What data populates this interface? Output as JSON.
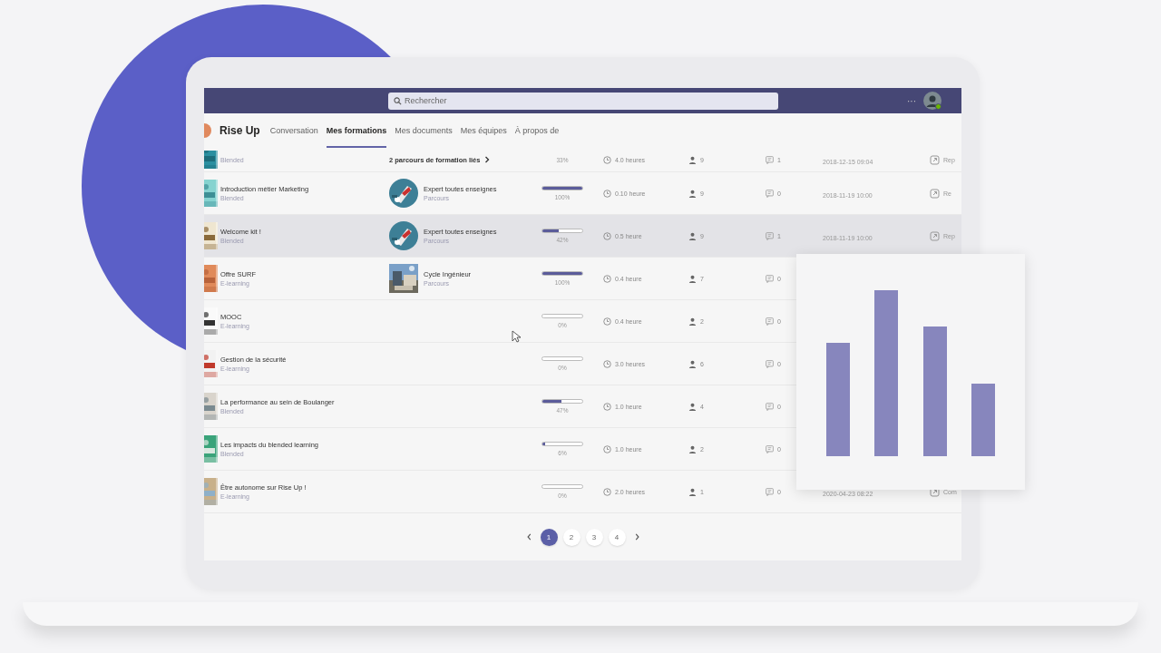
{
  "topbar": {
    "search": {
      "placeholder": "Rechercher"
    },
    "more": "···"
  },
  "app": {
    "title": "Rise Up"
  },
  "tabs": [
    {
      "label": "Conversation",
      "selected": false
    },
    {
      "label": "Mes formations",
      "selected": true
    },
    {
      "label": "Mes documents",
      "selected": false
    },
    {
      "label": "Mes équipes",
      "selected": false
    },
    {
      "label": "À propos de",
      "selected": false
    }
  ],
  "rows": [
    {
      "type": "Blended",
      "linked_paths": "2 parcours de formation liés",
      "progress": "33%",
      "duration": "4.0 heures",
      "learners": "9",
      "messages": "1",
      "date": "2018-12-15 09:04",
      "action": "Rep",
      "selected": false
    },
    {
      "title": "Introduction métier Marketing",
      "type": "Blended",
      "path": {
        "name": "Expert toutes enseignes",
        "type": "Parcours"
      },
      "level": 1,
      "progress": "100%",
      "duration": "0.10 heure",
      "learners": "9",
      "messages": "0",
      "date": "2018-11-19 10:00",
      "action": "Re",
      "selected": false
    },
    {
      "title": "Welcome kit !",
      "type": "Blended",
      "path": {
        "name": "Expert toutes enseignes",
        "type": "Parcours"
      },
      "level": 0.42,
      "progress": "42%",
      "duration": "0.5 heure",
      "learners": "9",
      "messages": "1",
      "date": "2018-11-19 10:00",
      "action": "Rep",
      "selected": true
    },
    {
      "title": "Offre SURF",
      "type": "E-learning",
      "path": {
        "name": "Cycle Ingénieur",
        "type": "Parcours"
      },
      "level": 1,
      "progress": "100%",
      "duration": "0.4 heure",
      "learners": "7",
      "messages": "0",
      "selected": false
    },
    {
      "title": "MOOC",
      "type": "E-learning",
      "progress": "0%",
      "duration": "0.4 heure",
      "learners": "2",
      "messages": "0",
      "selected": false
    },
    {
      "title": "Gestion de la sécurité",
      "type": "E-learning",
      "progress": "0%",
      "duration": "3.0 heures",
      "learners": "6",
      "messages": "0",
      "selected": false
    },
    {
      "title": "La performance au sein de Boulanger",
      "type": "Blended",
      "level": 0.47,
      "progress": "47%",
      "duration": "1.0 heure",
      "learners": "4",
      "messages": "0",
      "selected": false
    },
    {
      "title": "Les impacts du blended learning",
      "type": "Blended",
      "level": 0.06,
      "progress": "6%",
      "duration": "1.0 heure",
      "learners": "2",
      "messages": "0",
      "selected": false
    },
    {
      "title": "Être autonome sur Rise Up !",
      "type": "E-learning",
      "progress": "0%",
      "duration": "2.0 heures",
      "learners": "1",
      "messages": "0",
      "date": "2020-04-23 08:22",
      "action": "Com",
      "selected": false
    }
  ],
  "pagination": {
    "pages": [
      {
        "label": "1",
        "selected": true
      },
      {
        "label": "2",
        "selected": false
      },
      {
        "label": "3",
        "selected": false
      },
      {
        "label": "4",
        "selected": false
      }
    ]
  }
}
